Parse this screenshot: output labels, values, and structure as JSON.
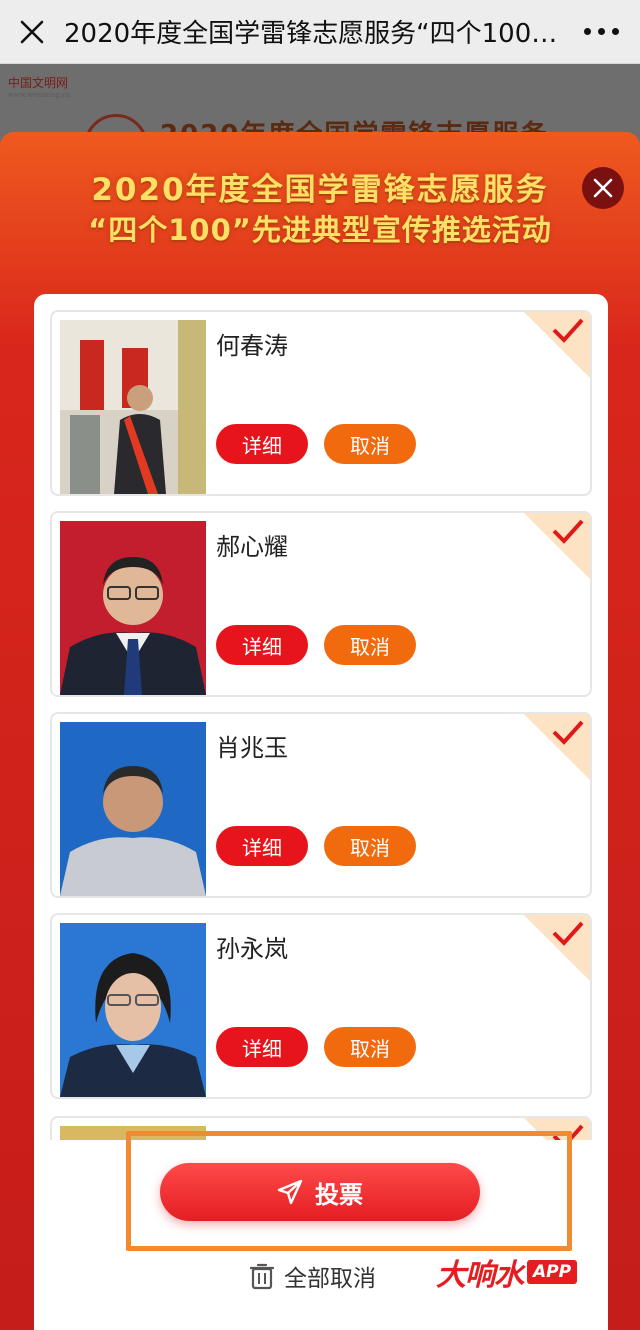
{
  "topbar": {
    "title": "2020年度全国学雷锋志愿服务“四个100”...",
    "close_icon": "close-icon",
    "more_icon": "more-icon"
  },
  "background_page": {
    "logo_text": "中国文明网",
    "logo_subtext": "www.wenming.cn",
    "title": "2020年度全国学雷锋志愿服务"
  },
  "modal": {
    "headline_line1": "2020年度全国学雷锋志愿服务",
    "headline_line2": "“四个100”先进典型宣传推选活动",
    "candidates": [
      {
        "name": "何春涛",
        "detail_label": "详细",
        "cancel_label": "取消",
        "selected": true
      },
      {
        "name": "郝心耀",
        "detail_label": "详细",
        "cancel_label": "取消",
        "selected": true
      },
      {
        "name": "肖兆玉",
        "detail_label": "详细",
        "cancel_label": "取消",
        "selected": true
      },
      {
        "name": "孙永岚",
        "detail_label": "详细",
        "cancel_label": "取消",
        "selected": true
      }
    ],
    "vote_label": "投票",
    "cancel_all_label": "全部取消"
  },
  "watermark": {
    "brand": "大响水",
    "app": "APP"
  },
  "colors": {
    "accent_red": "#e8141c",
    "accent_orange": "#f26a0e",
    "headline_yellow": "#ffe066",
    "highlight_orange": "#f28a32"
  }
}
